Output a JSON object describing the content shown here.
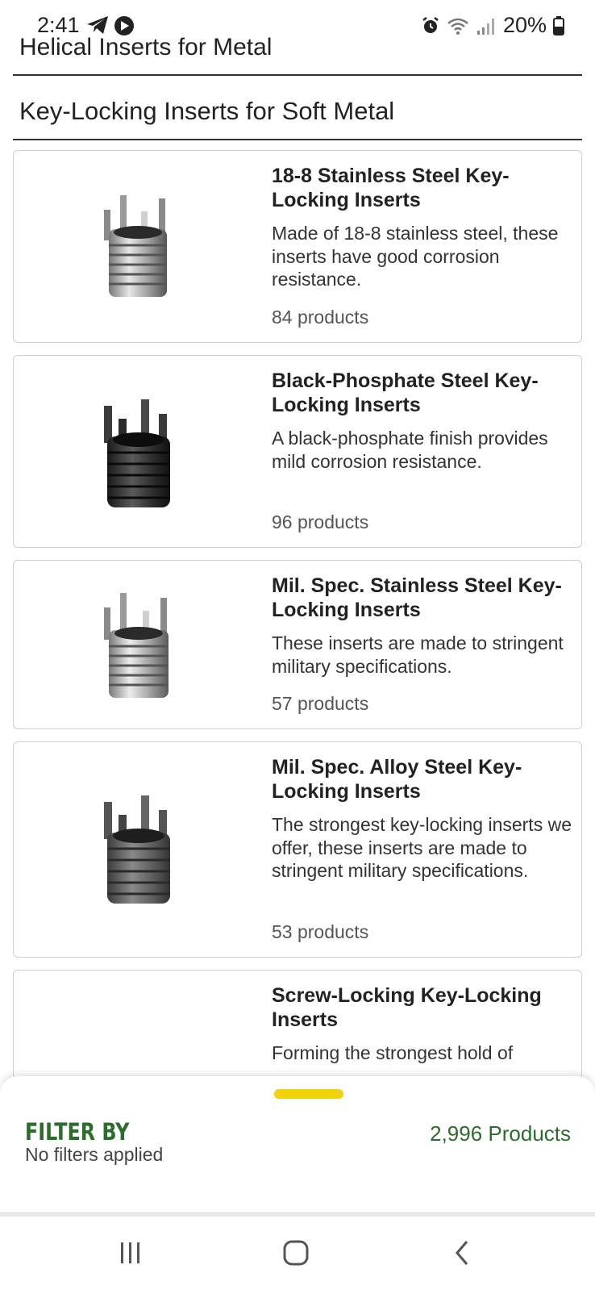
{
  "status_bar": {
    "time": "2:41",
    "battery": "20%"
  },
  "headers": {
    "prev_category": "Helical Inserts for Metal",
    "current_category": "Key-Locking Inserts for Soft Metal"
  },
  "cards": [
    {
      "title": "18-8 Stainless Steel Key-Locking Inserts",
      "description": "Made of 18-8 stainless steel, these inserts have good corrosion resistance.",
      "count": "84 products",
      "image_icon": "stainless-insert-icon"
    },
    {
      "title": "Black-Phosphate Steel Key-Locking Inserts",
      "description": "A black-phosphate finish provides mild corrosion resistance.",
      "count": "96 products",
      "image_icon": "black-insert-icon"
    },
    {
      "title": "Mil. Spec. Stainless Steel Key-Locking Inserts",
      "description": "These inserts are made to stringent military specifications.",
      "count": "57 products",
      "image_icon": "stainless-insert-icon"
    },
    {
      "title": "Mil. Spec. Alloy Steel Key-Locking Inserts",
      "description": "The strongest key-locking inserts we offer, these inserts are made to stringent military specifications.",
      "count": "53 products",
      "image_icon": "gray-insert-icon"
    },
    {
      "title": "Screw-Locking Key-Locking Inserts",
      "description": "Forming the strongest hold of"
    }
  ],
  "filter_panel": {
    "title": "FILTER BY",
    "subtitle": "No filters applied",
    "total": "2,996 Products"
  },
  "colors": {
    "accent_green": "#2e6b2e",
    "handle_yellow": "#f2d20a",
    "border_gray": "#cfcfcf"
  }
}
